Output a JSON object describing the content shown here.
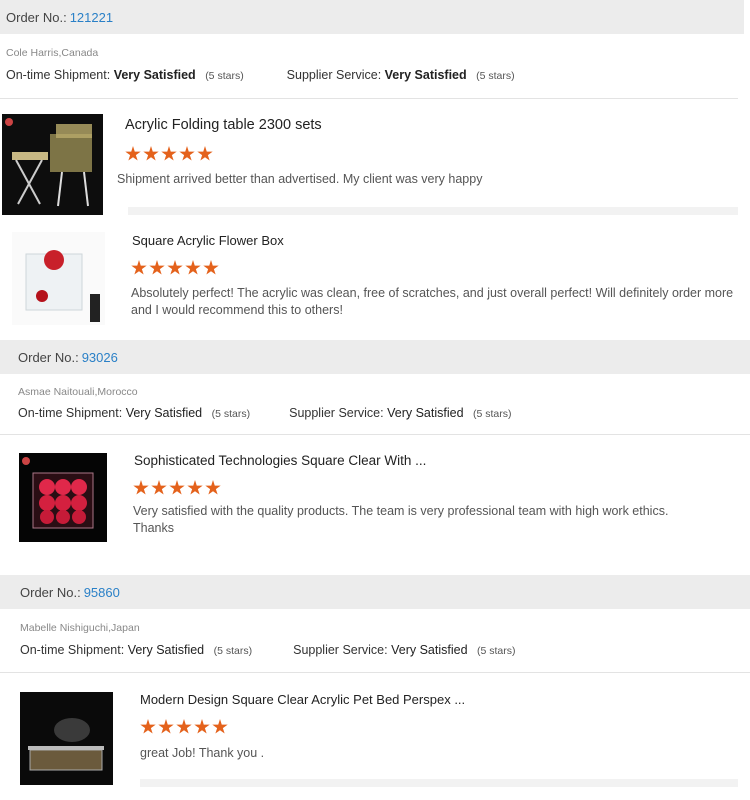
{
  "orders": [
    {
      "order_label": "Order No.:",
      "order_no": "121221",
      "buyer": "Cole Harris,Canada",
      "shipment_label": "On-time Shipment:",
      "shipment_value": "Very Satisfied",
      "shipment_stars": "(5 stars)",
      "service_label": "Supplier Service:",
      "service_value": "Very Satisfied",
      "service_stars": "(5 stars)",
      "items": [
        {
          "title": "Acrylic Folding table 2300 sets",
          "rating": 5,
          "comment": "Shipment arrived better than advertised. My client was very happy"
        },
        {
          "title": "Square Acrylic Flower Box",
          "rating": 5,
          "comment": "Absolutely perfect! The acrylic was clean, free of scratches, and just overall perfect! Will definitely order more and I would recommend this to others!"
        }
      ]
    },
    {
      "order_label": "Order No.:",
      "order_no": "93026",
      "buyer": "Asmae Naitouali,Morocco",
      "shipment_label": "On-time Shipment:",
      "shipment_value": "Very Satisfied",
      "shipment_stars": "(5 stars)",
      "service_label": "Supplier Service:",
      "service_value": "Very Satisfied",
      "service_stars": "(5 stars)",
      "items": [
        {
          "title": "Sophisticated Technologies Square Clear With ...",
          "rating": 5,
          "comment": "Very satisfied with the quality products. The team is very professional team with high work ethics. Thanks"
        }
      ]
    },
    {
      "order_label": "Order No.:",
      "order_no": "95860",
      "buyer": "Mabelle Nishiguchi,Japan",
      "shipment_label": "On-time Shipment:",
      "shipment_value": "Very Satisfied",
      "shipment_stars": "(5 stars)",
      "service_label": "Supplier Service:",
      "service_value": "Very Satisfied",
      "service_stars": "(5 stars)",
      "items": [
        {
          "title": "Modern Design Square Clear Acrylic Pet Bed Perspex ...",
          "rating": 5,
          "comment": "great Job! Thank you ."
        }
      ]
    }
  ],
  "colors": {
    "star": "#e4621c",
    "order_link": "#2a80c7",
    "header_bg": "#ececec"
  }
}
